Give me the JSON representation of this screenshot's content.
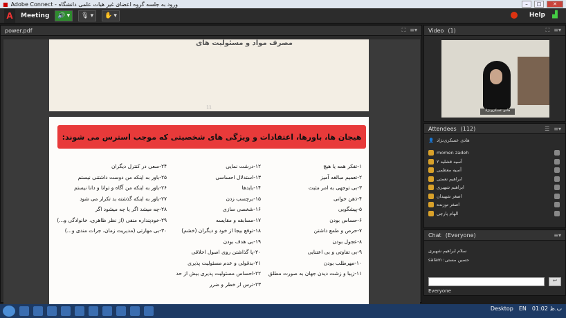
{
  "window": {
    "title": "ورود به جلسه  گروه اعضای غیر هیات علمی دانشگاه - Adobe Connect"
  },
  "menu": {
    "meeting": "Meeting",
    "help": "Help",
    "logo": "Adobe"
  },
  "pdf": {
    "title": "power.pdf",
    "top_heading": "مصرف مواد و مسئولیت های",
    "page_number": "11",
    "banner": "هیجان ها، باورها، اعتقادات و ویژگی های شخصیتی که موجب استرس می شوند:",
    "col1": [
      "۱-تفکر همه یا هیچ",
      "۲-تعمیم مبالغه آمیز",
      "۳-بی توجهی به امر مثبت",
      "۴-ذهن خوانی",
      "۵-پیشگویی",
      "۶-حساس بودن",
      "۷-حرص و طمع داشتن",
      "۸-عجول بودن",
      "۹-بی تفاوتی و بی اعتنایی",
      "۱۰-مهرطلب بودن",
      "۱۱-زیبا و زشت دیدن جهان به صورت مطلق"
    ],
    "col2": [
      "۱۲-درشت نمایی",
      "۱۳-استدلال احساسی",
      "۱۴-بایدها",
      "۱۵-برچسب زدن",
      "۱۶-شخصی سازی",
      "۱۷-مسابقه و مقایسه",
      "۱۸-توقع بیجا از خود و دیگران (خشم)",
      "۱۹-بی هدف بودن",
      "۲۰-پا گذاشتن روی اصول اخلاقی",
      "۲۱-بدقولی و عدم مسئولیت پذیری",
      "۲۲-احساس مسئولیت پذیری بیش از حد",
      "۲۳-ترس از خطر و ضرر"
    ],
    "col3": [
      "۲۴-سعی در کنترل دیگران",
      "۲۵-باور به اینکه من دوست داشتنی نیستم",
      "۲۶-باور به اینکه من آگاه و توانا و دانا نیستم",
      "۲۷-باور به اینکه گذشته بد تکرار می شود",
      "۲۸-چه میشد اگر یا چه میشود اگر",
      "۲۹-خودپنداره منفی (از نظر ظاهری، خانوادگی و...)",
      "۳۰-بی مهارتی (مدیریت زمان، جرات مندی و...)"
    ]
  },
  "video": {
    "title": "Video",
    "count": "(1)",
    "name": "هادی عسکری‌نژاد"
  },
  "attendees": {
    "title": "Attendees",
    "count": "(112)",
    "host": "هادی عسکری‌نژاد",
    "list": [
      "momen zadeh",
      "آسیه قشلیه ۲",
      "آسیه معظمی",
      "ابراهیم نعمتی",
      "ابراهیم شهیری",
      "اصغر شهیدان",
      "اصغر توزنده",
      "الهام پارچی"
    ]
  },
  "chat": {
    "title": "Chat",
    "scope": "(Everyone)",
    "messages": [
      "سلام ابراهیم شهیری",
      "salam :حسین مستی"
    ],
    "send": "↩",
    "to": "Everyone"
  },
  "taskbar": {
    "desktop": "Desktop",
    "lang": "EN",
    "time": "01:02 ب.ظ"
  }
}
